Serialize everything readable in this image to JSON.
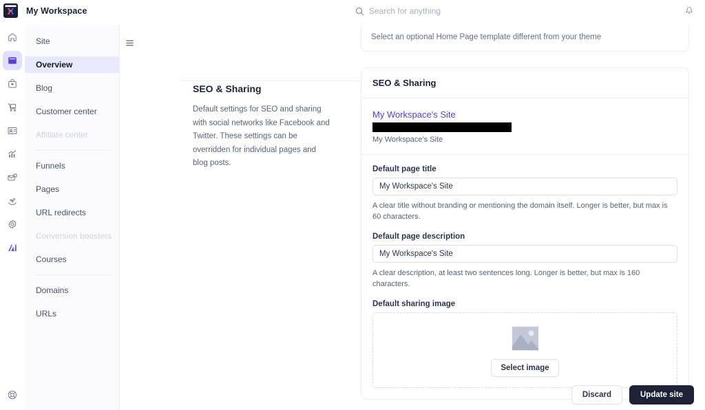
{
  "topbar": {
    "logo_icon": "workspace-logo-icon",
    "workspace_title": "My Workspace",
    "search": {
      "icon": "search-icon",
      "placeholder": "Search for anything",
      "value": ""
    },
    "notifications_icon": "bell-icon"
  },
  "rail": {
    "items": [
      {
        "icon": "home-icon",
        "name": "home",
        "active": false
      },
      {
        "icon": "site-icon",
        "name": "site",
        "active": true
      },
      {
        "icon": "products-icon",
        "name": "products",
        "active": false
      },
      {
        "icon": "cart-icon",
        "name": "orders",
        "active": false
      },
      {
        "icon": "contacts-icon",
        "name": "contacts",
        "active": false
      },
      {
        "icon": "analytics-icon",
        "name": "analytics",
        "active": false
      },
      {
        "icon": "marketing-email-icon",
        "name": "marketing",
        "active": false
      },
      {
        "icon": "growth-plant-icon",
        "name": "growth",
        "active": false
      },
      {
        "icon": "gear-icon",
        "name": "settings",
        "active": false
      },
      {
        "icon": "ai-icon",
        "name": "ai",
        "active": false
      }
    ],
    "bottom_item": {
      "icon": "lifebuoy-help-icon",
      "name": "help"
    }
  },
  "subnav": {
    "groups": [
      {
        "items": [
          {
            "label": "Site",
            "state": "header"
          },
          {
            "label": "Overview",
            "state": "active"
          },
          {
            "label": "Blog",
            "state": "normal"
          },
          {
            "label": "Customer center",
            "state": "normal"
          },
          {
            "label": "Affiliate center",
            "state": "disabled"
          }
        ]
      },
      {
        "items": [
          {
            "label": "Funnels",
            "state": "normal"
          },
          {
            "label": "Pages",
            "state": "normal"
          },
          {
            "label": "URL redirects",
            "state": "normal"
          },
          {
            "label": "Conversion boosters",
            "state": "disabled"
          },
          {
            "label": "Courses",
            "state": "normal"
          }
        ]
      },
      {
        "items": [
          {
            "label": "Domains",
            "state": "normal"
          },
          {
            "label": "URLs",
            "state": "normal"
          }
        ]
      }
    ]
  },
  "content": {
    "menu_toggle_icon": "hamburger-menu-icon",
    "previous_card_text": "Select an optional Home Page template different from your theme",
    "section": {
      "title": "SEO & Sharing",
      "description": "Default settings for SEO and sharing with social networks like Facebook and Twitter. These settings can be overridden for individual pages and blog posts.",
      "card_title": "SEO & Sharing",
      "serp_preview": {
        "title": "My Workspace's Site",
        "url_redacted": true,
        "description": "My Workspace's Site"
      },
      "fields": [
        {
          "label": "Default page title",
          "value": "My Workspace's Site",
          "placeholder": "Default page title",
          "help": "A clear title without branding or mentioning the domain itself. Longer is better, but max is 60 characters."
        },
        {
          "label": "Default page description",
          "value": "My Workspace's Site",
          "placeholder": "Default page description",
          "help": "A clear description, at least two sentences long. Longer is better, but max is 160 characters."
        }
      ],
      "sharing_image": {
        "label": "Default sharing image",
        "placeholder_icon": "image-placeholder-icon",
        "button_label": "Select image"
      }
    },
    "footer": {
      "discard_label": "Discard",
      "update_label": "Update site"
    }
  },
  "colors": {
    "accent": "#5b3fd6",
    "active_nav_bg": "#e8eafc",
    "dark_button": "#1d2239",
    "link_purple": "#5b3fd6",
    "muted_text": "#5c6179",
    "disabled_text": "#cfd3e0"
  }
}
